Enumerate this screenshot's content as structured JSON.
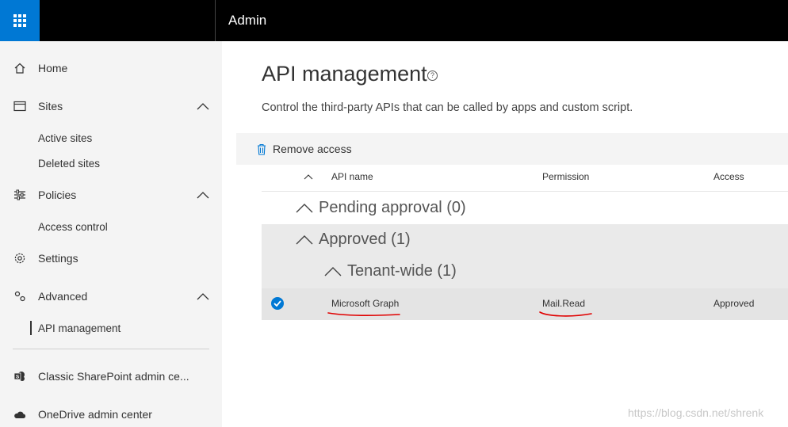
{
  "header": {
    "app_title": "Admin",
    "launcher_icon": "waffle-icon",
    "colors": {
      "launcher_bg": "#0078d4",
      "bar_bg": "#000000"
    }
  },
  "sidebar": {
    "items": [
      {
        "label": "Home",
        "icon": "home-icon"
      },
      {
        "label": "Sites",
        "icon": "sites-icon",
        "expanded": true,
        "children": [
          "Active sites",
          "Deleted sites"
        ]
      },
      {
        "label": "Policies",
        "icon": "policies-icon",
        "expanded": true,
        "children": [
          "Access control"
        ]
      },
      {
        "label": "Settings",
        "icon": "gear-icon"
      },
      {
        "label": "Advanced",
        "icon": "advanced-icon",
        "expanded": true,
        "children": [
          "API management"
        ]
      }
    ],
    "active": "API management",
    "footer_items": [
      {
        "label": "Classic SharePoint admin ce...",
        "icon": "sharepoint-icon"
      },
      {
        "label": "OneDrive admin center",
        "icon": "onedrive-icon"
      }
    ]
  },
  "main": {
    "title": "API management",
    "description": "Control the third-party APIs that can be called by apps and custom script.",
    "commands": {
      "remove_access": "Remove access"
    },
    "columns": {
      "name": "API name",
      "permission": "Permission",
      "access": "Access"
    },
    "groups": {
      "pending": "Pending approval (0)",
      "approved": "Approved (1)",
      "tenant_wide": "Tenant-wide (1)"
    },
    "rows": [
      {
        "name": "Microsoft Graph",
        "permission": "Mail.Read",
        "access": "Approved",
        "selected": true
      }
    ],
    "annotation_color": "#e00000"
  },
  "watermark": "https://blog.csdn.net/shrenk"
}
